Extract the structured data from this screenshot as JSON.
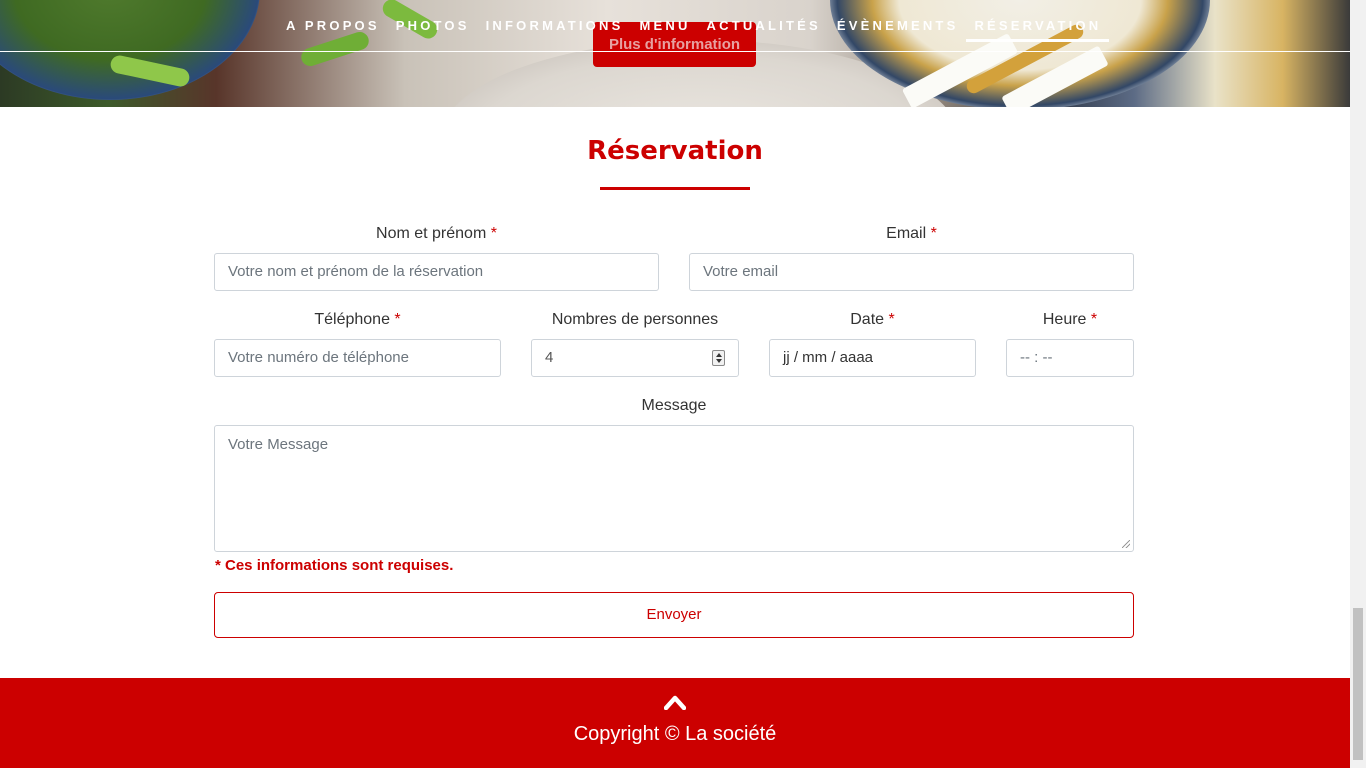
{
  "nav": {
    "items": [
      {
        "label": "A PROPOS",
        "active": false
      },
      {
        "label": "PHOTOS",
        "active": false
      },
      {
        "label": "INFORMATIONS",
        "active": false
      },
      {
        "label": "MENU",
        "active": false
      },
      {
        "label": "ACTUALITÉS",
        "active": false
      },
      {
        "label": "ÉVÈNEMENTS",
        "active": false
      },
      {
        "label": "RÉSERVATION",
        "active": true
      }
    ]
  },
  "hero": {
    "more_button_label": "Plus d'information"
  },
  "reservation": {
    "title": "Réservation",
    "required_mark": "*",
    "fields": {
      "name": {
        "label": "Nom et prénom",
        "placeholder": "Votre nom et prénom de la réservation"
      },
      "email": {
        "label": "Email",
        "placeholder": "Votre email"
      },
      "phone": {
        "label": "Téléphone",
        "placeholder": "Votre numéro de téléphone"
      },
      "people": {
        "label": "Nombres de personnes",
        "value": "4"
      },
      "date": {
        "label": "Date",
        "value": "jj / mm / aaaa"
      },
      "time": {
        "label": "Heure",
        "value": "-- : --"
      },
      "message": {
        "label": "Message",
        "placeholder": "Votre Message"
      }
    },
    "required_note": "* Ces informations sont requises.",
    "submit_label": "Envoyer"
  },
  "footer": {
    "copyright": "Copyright © La société",
    "up_icon": "chevron-up-icon"
  },
  "colors": {
    "accent": "#cc0000",
    "border": "#ced4da"
  }
}
